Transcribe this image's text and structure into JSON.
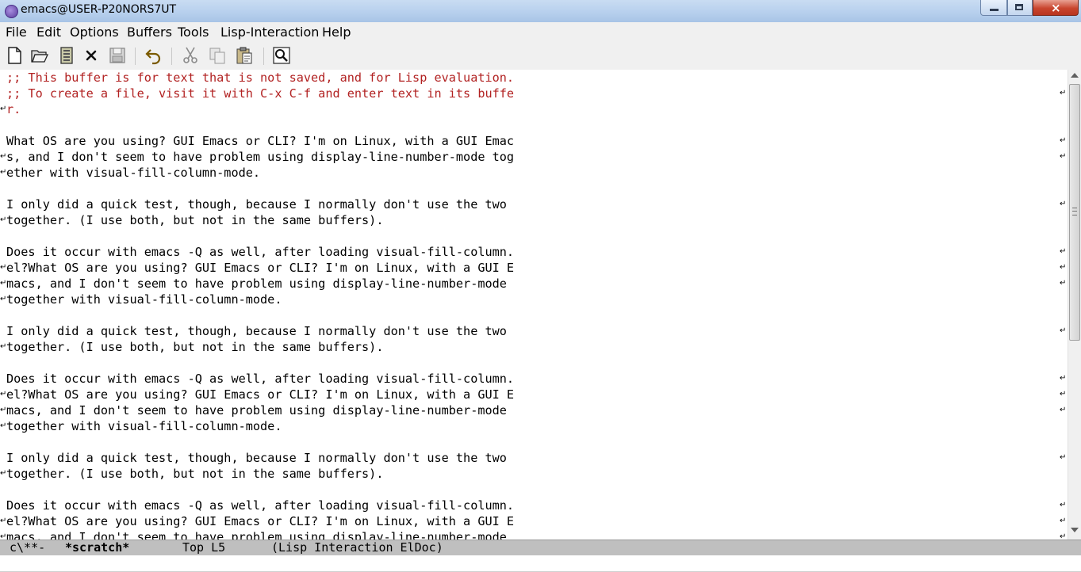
{
  "window": {
    "title": "emacs@USER-P20NORS7UT"
  },
  "menu": [
    "File",
    "Edit",
    "Options",
    "Buffers",
    "Tools",
    "Lisp-Interaction",
    "Help"
  ],
  "toolbar": {
    "icons": [
      "new-file-icon",
      "open-folder-icon",
      "open-directory-icon",
      "close-buffer-icon",
      "save-icon",
      "undo-icon",
      "cut-icon",
      "copy-icon",
      "paste-icon",
      "search-icon"
    ],
    "close_glyph": "×"
  },
  "buffer": {
    "lines": [
      {
        "text": ";; This buffer is for text that is not saved, and for Lisp evaluation.",
        "face": "comment"
      },
      {
        "text": ";; To create a file, visit it with C-x C-f and enter text in its buffe",
        "face": "comment"
      },
      {
        "text": "r.",
        "face": "comment"
      },
      {
        "text": "",
        "face": "default"
      },
      {
        "text": "What OS are you using? GUI Emacs or CLI? I'm on Linux, with a GUI Emac",
        "face": "default"
      },
      {
        "text": "s, and I don't seem to have problem using display-line-number-mode tog",
        "face": "default"
      },
      {
        "text": "ether with visual-fill-column-mode.",
        "face": "default"
      },
      {
        "text": "",
        "face": "default"
      },
      {
        "text": "I only did a quick test, though, because I normally don't use the two",
        "face": "default"
      },
      {
        "text": "together. (I use both, but not in the same buffers).",
        "face": "default"
      },
      {
        "text": "",
        "face": "default"
      },
      {
        "text": "Does it occur with emacs -Q as well, after loading visual-fill-column.",
        "face": "default"
      },
      {
        "text": "el?What OS are you using? GUI Emacs or CLI? I'm on Linux, with a GUI E",
        "face": "default"
      },
      {
        "text": "macs, and I don't seem to have problem using display-line-number-mode",
        "face": "default"
      },
      {
        "text": "together with visual-fill-column-mode.",
        "face": "default"
      },
      {
        "text": "",
        "face": "default"
      },
      {
        "text": "I only did a quick test, though, because I normally don't use the two",
        "face": "default"
      },
      {
        "text": "together. (I use both, but not in the same buffers).",
        "face": "default"
      },
      {
        "text": "",
        "face": "default"
      },
      {
        "text": "Does it occur with emacs -Q as well, after loading visual-fill-column.",
        "face": "default"
      },
      {
        "text": "el?What OS are you using? GUI Emacs or CLI? I'm on Linux, with a GUI E",
        "face": "default"
      },
      {
        "text": "macs, and I don't seem to have problem using display-line-number-mode",
        "face": "default"
      },
      {
        "text": "together with visual-fill-column-mode.",
        "face": "default"
      },
      {
        "text": "",
        "face": "default"
      },
      {
        "text": "I only did a quick test, though, because I normally don't use the two",
        "face": "default"
      },
      {
        "text": "together. (I use both, but not in the same buffers).",
        "face": "default"
      },
      {
        "text": "",
        "face": "default"
      },
      {
        "text": "Does it occur with emacs -Q as well, after loading visual-fill-column.",
        "face": "default"
      },
      {
        "text": "el?What OS are you using? GUI Emacs or CLI? I'm on Linux, with a GUI E",
        "face": "default"
      },
      {
        "text": "macs, and I don't seem to have problem using display-line-number-mode",
        "face": "default"
      }
    ],
    "left_fringe_glyph": "↵",
    "right_fringe_glyph": "↵",
    "continued_lines": [
      2,
      5,
      6,
      9,
      12,
      13,
      14,
      17,
      20,
      21,
      22,
      25,
      28,
      29
    ],
    "wrapped_lines": [
      1,
      4,
      5,
      8,
      11,
      12,
      13,
      16,
      19,
      20,
      21,
      24,
      27,
      28,
      29
    ],
    "colors": {
      "comment": "#b22222",
      "text": "#000000",
      "background": "#ffffff"
    }
  },
  "modeline": {
    "status": "c\\**-",
    "buffer_name": "*scratch*",
    "position": "Top L5",
    "modes": "(Lisp Interaction ElDoc)"
  },
  "minibuffer": {
    "text": ""
  }
}
